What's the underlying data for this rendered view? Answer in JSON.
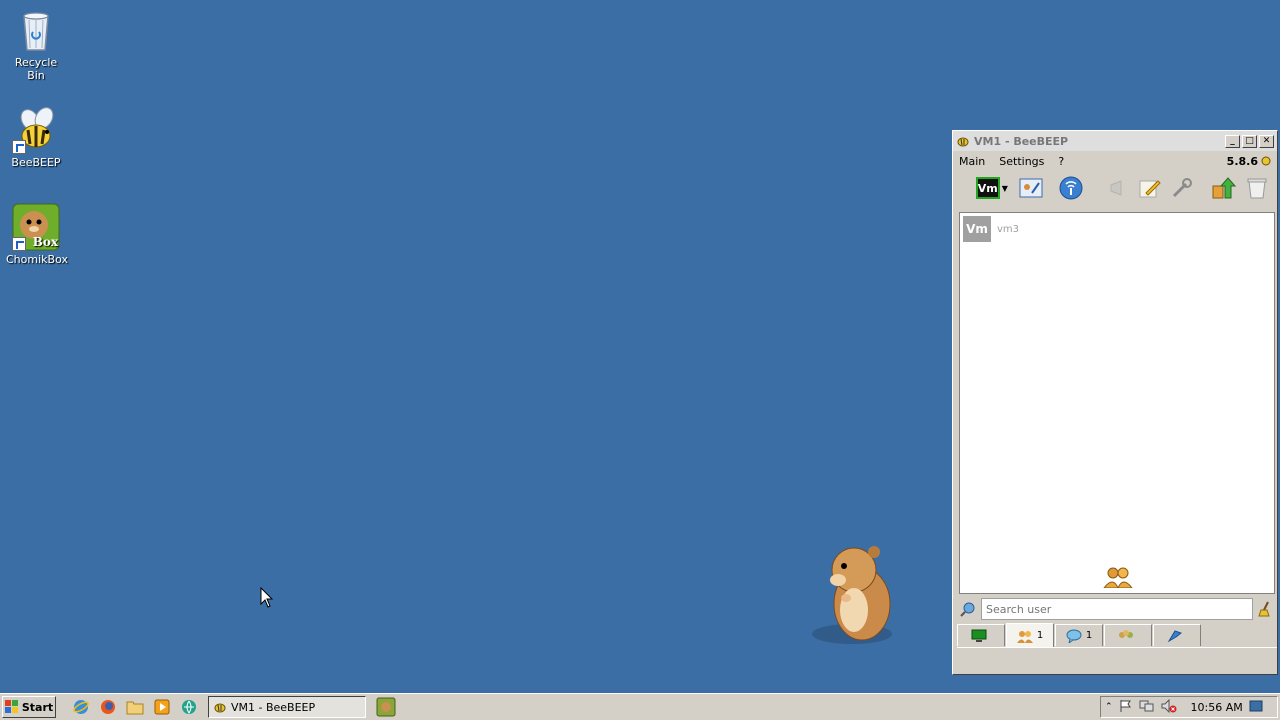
{
  "desktop": {
    "icons": [
      {
        "label": "Recycle Bin"
      },
      {
        "label": "BeeBEEP"
      },
      {
        "label": "ChomikBox",
        "badge": "Box"
      }
    ]
  },
  "window": {
    "title": "VM1 - BeeBEEP",
    "menu": [
      "Main",
      "Settings",
      "?"
    ],
    "version": "5.8.6",
    "vm_badge": "Vm",
    "users": [
      {
        "avatar": "Vm",
        "name": "vm3"
      }
    ],
    "search_placeholder": "Search user",
    "tabs": [
      {
        "icon": "computer-icon",
        "count": ""
      },
      {
        "icon": "users-icon",
        "count": "1"
      },
      {
        "icon": "chat-icon",
        "count": "1"
      },
      {
        "icon": "group-icon",
        "count": ""
      },
      {
        "icon": "share-icon",
        "count": ""
      }
    ]
  },
  "taskbar": {
    "start_label": "Start",
    "task_label": "VM1 - BeeBEEP",
    "clock": "10:56 AM"
  },
  "colors": {
    "desktop": "#3a6ea5",
    "window_face": "#d4d0c8",
    "vm_border": "#1fa81f"
  }
}
